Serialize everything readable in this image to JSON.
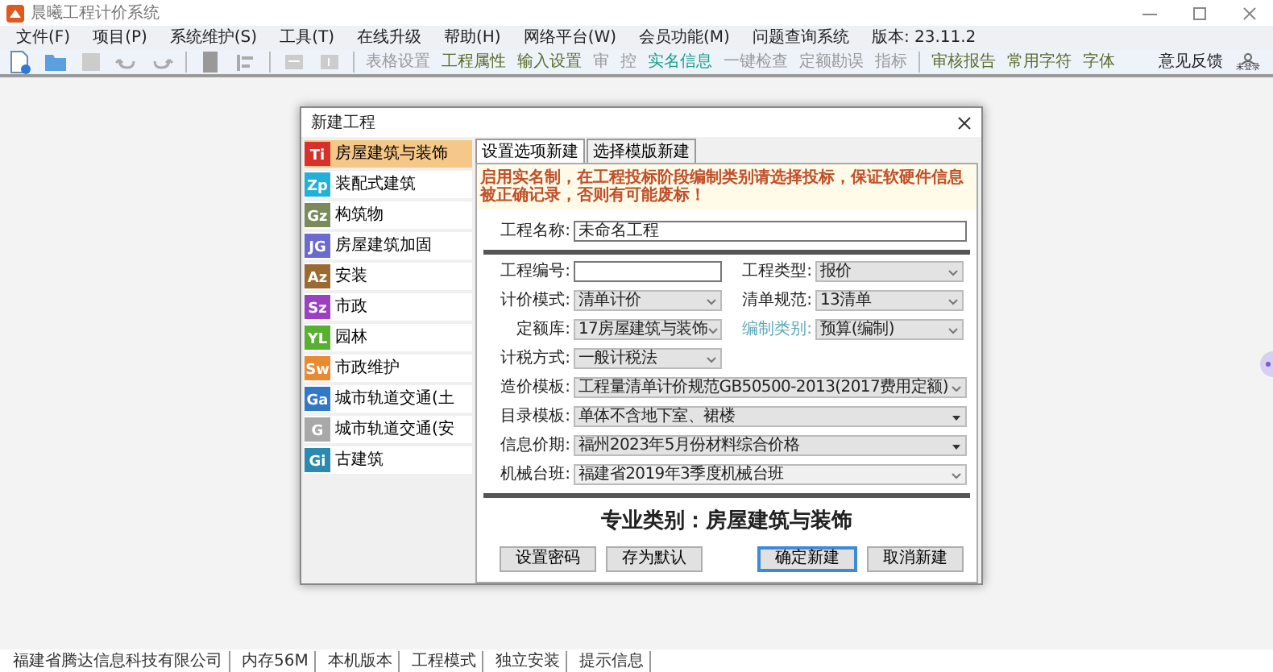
{
  "window": {
    "title": "晨曦工程计价系统"
  },
  "menu": [
    "文件(F)",
    "项目(P)",
    "系统维护(S)",
    "工具(T)",
    "在线升级",
    "帮助(H)",
    "网络平台(W)",
    "会员功能(M)",
    "问题查询系统"
  ],
  "version": "版本: 23.11.2",
  "toolbar": [
    {
      "label": "表格设置",
      "disabled": true,
      "highlight": false
    },
    {
      "label": "工程属性",
      "disabled": false,
      "highlight": false
    },
    {
      "label": "输入设置",
      "disabled": false,
      "highlight": false
    },
    {
      "label": "审",
      "disabled": true,
      "highlight": false
    },
    {
      "label": "控",
      "disabled": true,
      "highlight": false
    },
    {
      "label": "实名信息",
      "disabled": false,
      "highlight": true
    },
    {
      "label": "一键检查",
      "disabled": true,
      "highlight": false
    },
    {
      "label": "定额勘误",
      "disabled": true,
      "highlight": false
    },
    {
      "label": "指标",
      "disabled": true,
      "highlight": false
    },
    {
      "label": "审核报告",
      "disabled": false,
      "highlight": false
    },
    {
      "label": "常用字符",
      "disabled": false,
      "highlight": false
    },
    {
      "label": "字体",
      "disabled": false,
      "highlight": false
    }
  ],
  "feedback": "意见反馈",
  "user": "未登录",
  "dialog": {
    "title": "新建工程",
    "categories": [
      {
        "code": "Ti",
        "label": "房屋建筑与装饰",
        "color": "#d8302a",
        "selected": true
      },
      {
        "code": "Zp",
        "label": "装配式建筑",
        "color": "#20b0d8",
        "selected": false
      },
      {
        "code": "Gz",
        "label": "构筑物",
        "color": "#7a8a5a",
        "selected": false
      },
      {
        "code": "JG",
        "label": "房屋建筑加固",
        "color": "#6a6ad0",
        "selected": false
      },
      {
        "code": "Az",
        "label": "安装",
        "color": "#9a6a30",
        "selected": false
      },
      {
        "code": "Sz",
        "label": "市政",
        "color": "#9a40c0",
        "selected": false
      },
      {
        "code": "YL",
        "label": "园林",
        "color": "#58b030",
        "selected": false
      },
      {
        "code": "Sw",
        "label": "市政维护",
        "color": "#e88a30",
        "selected": false
      },
      {
        "code": "Ga",
        "label": "城市轨道交通(土",
        "color": "#3078c8",
        "selected": false
      },
      {
        "code": "G",
        "label": "城市轨道交通(安",
        "color": "#a8a8a8",
        "selected": false
      },
      {
        "code": "Gi",
        "label": "古建筑",
        "color": "#2a8ab0",
        "selected": false
      }
    ],
    "tabs": [
      {
        "label": "设置选项新建",
        "selected": true
      },
      {
        "label": "选择模版新建",
        "selected": false
      }
    ],
    "notice": "启用实名制，在工程投标阶段编制类别请选择投标，保证软硬件信息被正确记录，否则有可能废标！",
    "sections": [
      [
        [
          {
            "kind": "text",
            "label": "工程名称:",
            "value": "未命名工程",
            "disabled": false
          }
        ]
      ],
      [
        [
          {
            "kind": "text",
            "label": "工程编号:",
            "disabled": false
          },
          {
            "kind": "select",
            "label": "工程类型:",
            "value": "报价",
            "disabled": false
          }
        ],
        [
          {
            "kind": "select",
            "label": "计价模式:",
            "value": "清单计价",
            "disabled": false
          },
          {
            "kind": "select",
            "label": "清单规范:",
            "value": "13清单",
            "disabled": false
          }
        ],
        [
          {
            "kind": "select",
            "label": "定额库:",
            "value": "17房屋建筑与装饰",
            "disabled": false
          },
          {
            "kind": "select",
            "label": "编制类别:",
            "value": "预算(编制)",
            "disabled": true
          }
        ],
        [
          {
            "kind": "short",
            "label": "计税方式:",
            "value": "一般计税法",
            "disabled": false
          }
        ],
        [
          {
            "kind": "select",
            "label": "造价模板:",
            "value": "工程量清单计价规范GB50500-2013(2017费用定额)",
            "disabled": false
          }
        ],
        [
          {
            "kind": "dropdown",
            "label": "目录模板:",
            "value": "单体不含地下室、裙楼",
            "disabled": false
          }
        ],
        [
          {
            "kind": "dropdown",
            "label": "信息价期:",
            "value": "福州2023年5月份材料综合价格",
            "disabled": false
          }
        ],
        [
          {
            "kind": "combo",
            "label": "机械台班:",
            "value": "福建省2019年3季度机械台班",
            "disabled": false
          }
        ]
      ]
    ],
    "category_title": "专业类别：房屋建筑与装饰",
    "buttons": [
      {
        "label": "设置密码",
        "default": false
      },
      {
        "label": "存为默认",
        "default": false
      },
      {
        "label": "确定新建",
        "default": true
      },
      {
        "label": "取消新建",
        "default": false
      }
    ]
  },
  "status_bar": [
    "福建省腾达信息科技有限公司",
    "内存56M",
    "本机版本",
    "工程模式",
    "独立安装",
    "提示信息"
  ]
}
